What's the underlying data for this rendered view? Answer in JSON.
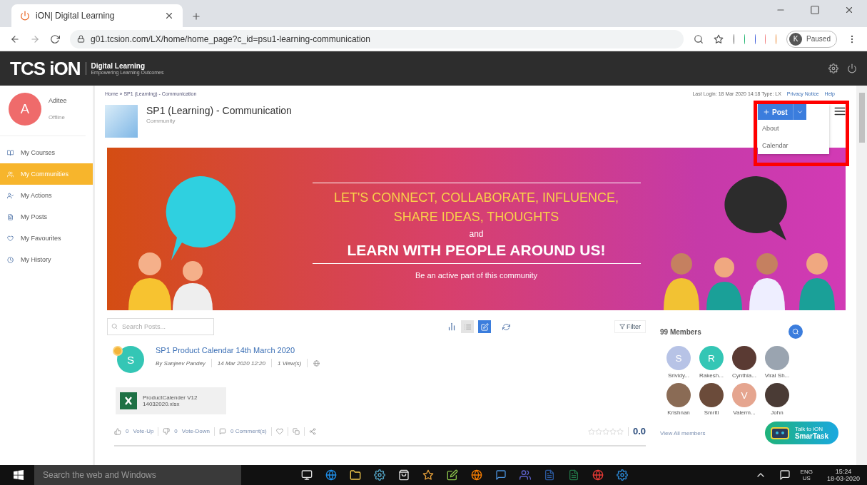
{
  "browser": {
    "tab_title": "iON| Digital Learning",
    "url": "g01.tcsion.com/LX/home/home_page?c_id=psu1-learning-communication",
    "profile_letter": "K",
    "profile_status": "Paused"
  },
  "header": {
    "logo": "TCS iON",
    "product": "Digital Learning",
    "tagline": "Empowering Learning Outcomes"
  },
  "sidebar": {
    "user": {
      "letter": "A",
      "name": "Aditee",
      "status": "Offline"
    },
    "items": [
      {
        "label": "My Courses",
        "selected": false
      },
      {
        "label": "My Communities",
        "selected": true
      },
      {
        "label": "My Actions",
        "selected": false
      },
      {
        "label": "My Posts",
        "selected": false
      },
      {
        "label": "My Favourites",
        "selected": false
      },
      {
        "label": "My History",
        "selected": false
      }
    ]
  },
  "breadcrumb": "Home » SP1 (Learning) - Communication",
  "last_login": "Last Login: 18 Mar 2020 14:18 Type: LX",
  "top_links": [
    "Privacy Notice",
    "Help"
  ],
  "community": {
    "title": "SP1 (Learning) - Communication",
    "subtitle": "Community"
  },
  "post_button": "Post",
  "menu": [
    "About",
    "Calendar"
  ],
  "banner": {
    "line_1": "LET'S CONNECT, COLLABORATE, INFLUENCE,",
    "line_2": "SHARE IDEAS, THOUGHTS",
    "joiner": "and",
    "headline": "LEARN WITH PEOPLE AROUND US!",
    "tagline": "Be an active part of this community"
  },
  "toolbar": {
    "search_placeholder": "Search Posts...",
    "views": [
      {
        "kind": "list",
        "selected": false
      },
      {
        "kind": "grid",
        "selected": true
      }
    ],
    "filter": "Filter"
  },
  "post": {
    "avatar": "S",
    "title": "SP1 Product Calendar 14th March 2020",
    "author": "By Sanjeev Pandey",
    "date": "14 Mar 2020 12:20",
    "views": "1 View(s)",
    "attachment": {
      "line_1": "ProductCalender V12",
      "line_2": "14032020.xlsx"
    },
    "vote_up_count": "0",
    "vote_up": "Vote-Up",
    "vote_down_count": "0",
    "vote_down": "Vote-Down",
    "comments": "0 Comment(s)",
    "stars": 0,
    "rating": "0.0"
  },
  "members": {
    "count": "99 Members",
    "list": [
      {
        "name": "Srividy...",
        "letter": "S",
        "color": "#b7c3e6"
      },
      {
        "name": "Rakesh...",
        "letter": "R",
        "color": "#34c6b5"
      },
      {
        "name": "Cynthia...",
        "color": "#5a3a33"
      },
      {
        "name": "Viral Sh...",
        "color": "#9aa4b0"
      },
      {
        "name": "Krishnan",
        "color": "#8a6b55"
      },
      {
        "name": "Smriti",
        "color": "#6b4b3a"
      },
      {
        "name": "Valerm...",
        "letter": "V",
        "color": "#e5a58f"
      },
      {
        "name": "John",
        "color": "#4a3b35"
      }
    ],
    "view_all": "View All members"
  },
  "chat": {
    "line_1": "Talk to iON",
    "line_2": "SmarTask"
  },
  "taskbar": {
    "search": "Search the web and Windows",
    "lang": "ENG",
    "region": "US",
    "time": "15:24",
    "date": "18-03-2020"
  }
}
